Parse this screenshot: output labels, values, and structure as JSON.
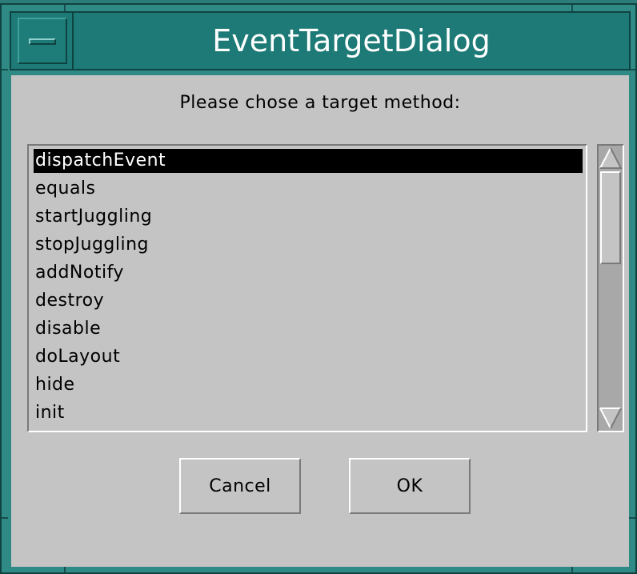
{
  "window": {
    "title": "EventTargetDialog"
  },
  "dialog": {
    "prompt": "Please chose a target method:",
    "methods": [
      "dispatchEvent",
      "equals",
      "startJuggling",
      "stopJuggling",
      "addNotify",
      "destroy",
      "disable",
      "doLayout",
      "hide",
      "init"
    ],
    "selected_method": "dispatchEvent",
    "cancel_label": "Cancel",
    "ok_label": "OK"
  },
  "scrollbar": {
    "up_icon": "scroll-up-arrow",
    "down_icon": "scroll-down-arrow"
  },
  "colors": {
    "frame": "#2f8a86",
    "titlebar": "#1d7a76",
    "title_text": "#ffffff",
    "client_bg": "#c4c4c4",
    "selection_bg": "#000000",
    "selection_text": "#ffffff"
  }
}
